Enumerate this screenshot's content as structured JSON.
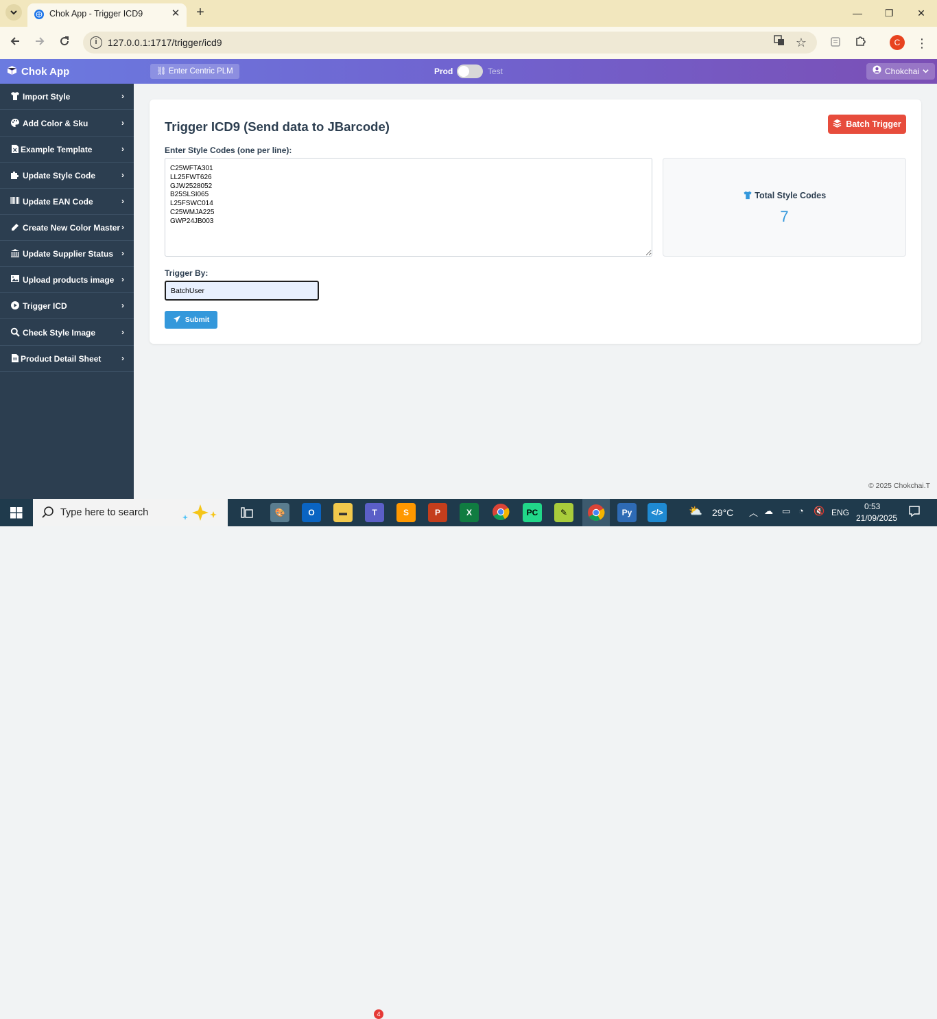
{
  "browser": {
    "tab_title": "Chok App - Trigger ICD9",
    "url": "127.0.0.1:1717/trigger/icd9",
    "profile_initial": "C"
  },
  "navbar": {
    "brand": "Chok App",
    "centric_label": "Enter Centric PLM",
    "env_prod": "Prod",
    "env_test": "Test",
    "user": "Chokchai"
  },
  "sidebar": {
    "items": [
      {
        "label": "Import Style",
        "icon": "tshirt-icon"
      },
      {
        "label": "Add Color & Sku",
        "icon": "palette-icon"
      },
      {
        "label": "Example Template",
        "icon": "excel-file-icon"
      },
      {
        "label": "Update Style Code",
        "icon": "puzzle-icon"
      },
      {
        "label": "Update EAN Code",
        "icon": "barcode-icon"
      },
      {
        "label": "Create New Color Master",
        "icon": "eyedropper-icon"
      },
      {
        "label": "Update Supplier Status",
        "icon": "bank-icon"
      },
      {
        "label": "Upload products image",
        "icon": "image-icon"
      },
      {
        "label": "Trigger ICD",
        "icon": "play-circle-icon"
      },
      {
        "label": "Check Style Image",
        "icon": "search-icon"
      },
      {
        "label": "Product Detail Sheet",
        "icon": "pdf-file-icon"
      }
    ]
  },
  "main": {
    "title": "Trigger ICD9 (Send data to JBarcode)",
    "batch_button": "Batch Trigger",
    "codes_label": "Enter Style Codes (one per line):",
    "codes_value": "C25WFTA301\nLL25FWT626\nGJW2528052\nB25SLSI065\nL25FSWC014\nC25WMJA225\nGWP24JB003",
    "stats_label": "Total Style Codes",
    "stats_value": "7",
    "trigger_label": "Trigger By:",
    "trigger_value": "BatchUser",
    "submit_button": "Submit"
  },
  "footer": {
    "copyright": "© 2025 Chokchai.T"
  },
  "taskbar": {
    "search_placeholder": "Type here to search",
    "weather": "29°C",
    "language": "ENG",
    "time": "0:53",
    "date": "21/09/2025",
    "teams_badge": "4"
  },
  "colors": {
    "sidebar_bg": "#2c3e50",
    "accent_blue": "#3498db",
    "batch_red": "#e74c3c",
    "navbar_start": "#6b7be0",
    "navbar_end": "#7b4fb5"
  }
}
